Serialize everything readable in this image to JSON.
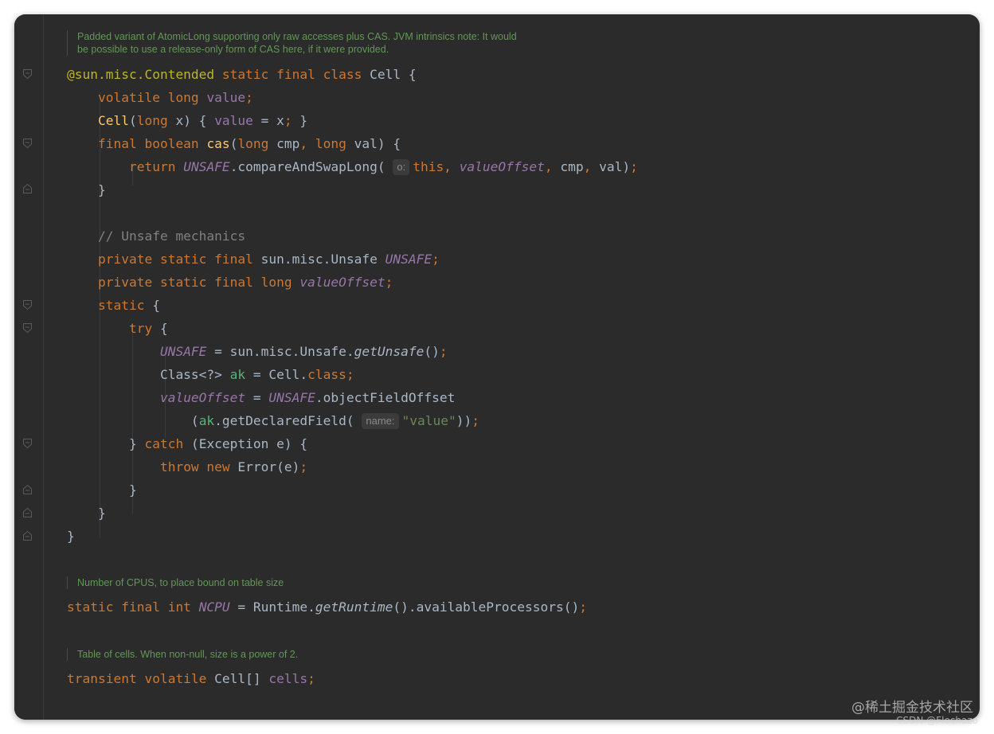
{
  "editor": {
    "doc_comments": [
      "Padded variant of AtomicLong supporting only raw accesses plus CAS. JVM intrinsics note: It would",
      "be possible to use a release-only form of CAS here, if it were provided.",
      "Number of CPUS, to place bound on table size",
      "Table of cells. When non-null, size is a power of 2."
    ],
    "hints": {
      "o": "o:",
      "name": "name:"
    },
    "comment_line": "// Unsafe mechanics",
    "string_value": "\"value\"",
    "colors": {
      "background": "#2b2b2b",
      "keyword": "#cc7832",
      "annotation": "#bbb529",
      "field": "#9876aa",
      "method": "#ffc66d",
      "comment": "#808080",
      "string": "#6a8759",
      "doc_comment": "#629755",
      "default_text": "#a9b7c6"
    }
  },
  "watermark": {
    "line1": "@稀土掘金技术社区",
    "line2": "CSDN @Flechazo"
  }
}
